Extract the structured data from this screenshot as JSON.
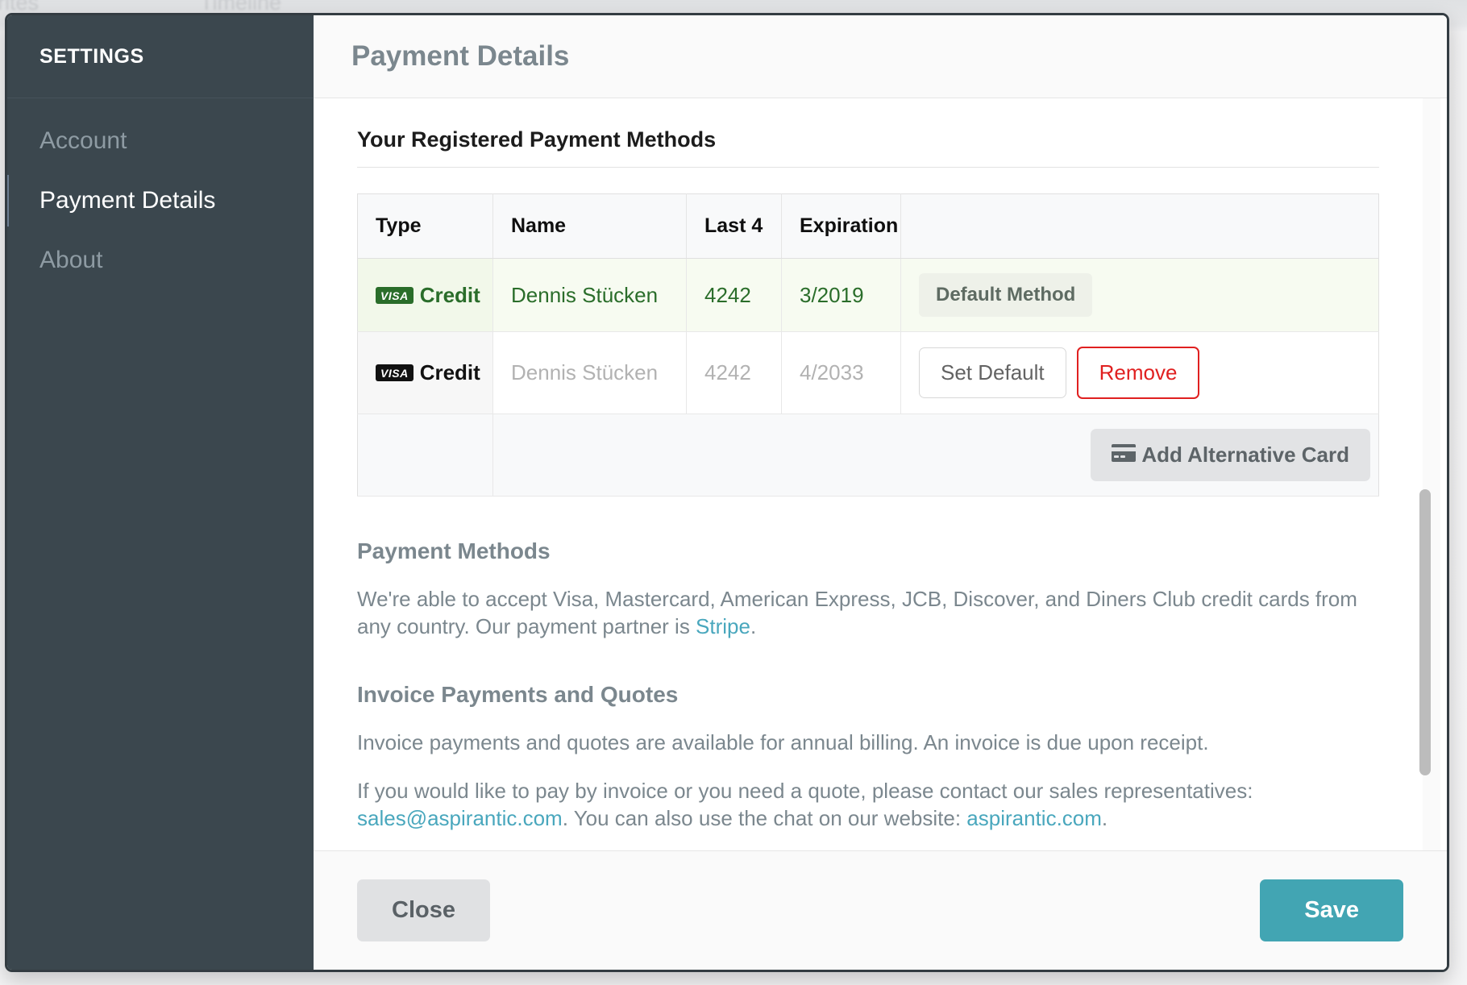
{
  "background": {
    "tab_left": "orites",
    "tab_right": "Timeline"
  },
  "sidebar": {
    "title": "SETTINGS",
    "items": [
      {
        "label": "Account",
        "active": false
      },
      {
        "label": "Payment Details",
        "active": true
      },
      {
        "label": "About",
        "active": false
      }
    ]
  },
  "header": {
    "title": "Payment Details"
  },
  "main": {
    "section_title": "Your Registered Payment Methods",
    "table": {
      "columns": [
        "Type",
        "Name",
        "Last 4",
        "Expiration",
        ""
      ],
      "rows": [
        {
          "type_brand": "VISA",
          "type_label": "Credit",
          "name": "Dennis Stücken",
          "last4": "4242",
          "expiration": "3/2019",
          "status_badge": "Default Method"
        },
        {
          "type_brand": "VISA",
          "type_label": "Credit",
          "name": "Dennis Stücken",
          "last4": "4242",
          "expiration": "4/2033",
          "set_default_label": "Set Default",
          "remove_label": "Remove"
        }
      ],
      "add_card_label": "Add Alternative Card",
      "add_card_icon": "credit-card-icon"
    },
    "sections": [
      {
        "heading": "Payment Methods",
        "paragraph_part1": "We're able to accept Visa, Mastercard, American Express, JCB, Discover, and Diners Club credit cards from any country. Our payment partner is ",
        "link_text": "Stripe",
        "paragraph_part2": "."
      },
      {
        "heading": "Invoice Payments and Quotes",
        "paragraph": "Invoice payments and quotes are available for annual billing. An invoice is due upon receipt.",
        "contact_part1": "If you would like to pay by invoice or you need a quote, please contact our sales representatives: ",
        "contact_email": "sales@aspirantic.com",
        "contact_part2": ". You can also use the chat on our website: ",
        "contact_site": "aspirantic.com",
        "contact_part3": "."
      }
    ]
  },
  "footer": {
    "close_label": "Close",
    "save_label": "Save"
  },
  "colors": {
    "sidebar_bg": "#3b474e",
    "accent_teal": "#42a5b3",
    "link": "#49a7bd",
    "danger": "#e02020",
    "default_row_text": "#2a6d2a",
    "muted_text": "#b2b2b2"
  }
}
